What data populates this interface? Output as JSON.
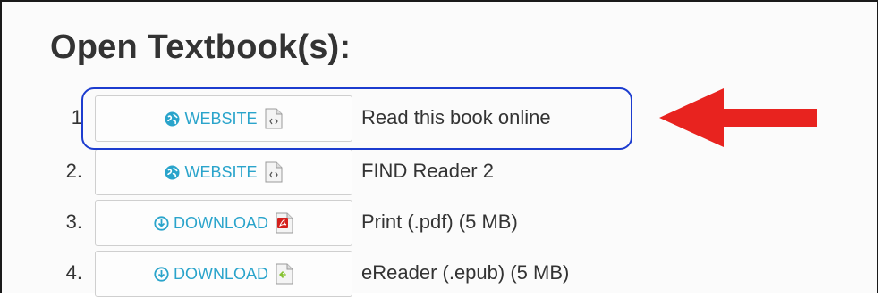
{
  "section": {
    "title": "Open Textbook(s):"
  },
  "items": [
    {
      "number": "1",
      "button_label": "WEBSITE",
      "button_icon": "globe-icon",
      "file_icon": "html-file-icon",
      "description": "Read this book online"
    },
    {
      "number": "2.",
      "button_label": "WEBSITE",
      "button_icon": "globe-icon",
      "file_icon": "html-file-icon",
      "description": "FIND Reader 2"
    },
    {
      "number": "3.",
      "button_label": "DOWNLOAD",
      "button_icon": "download-circle-icon",
      "file_icon": "pdf-file-icon",
      "description": "Print (.pdf) (5 MB)"
    },
    {
      "number": "4.",
      "button_label": "DOWNLOAD",
      "button_icon": "download-circle-icon",
      "file_icon": "epub-file-icon",
      "description": "eReader (.epub) (5 MB)"
    }
  ],
  "annotation": {
    "highlight_color": "#1c3ccf",
    "arrow_color": "#e8231f"
  },
  "colors": {
    "button_text": "#2aa4cb",
    "text": "#333333"
  }
}
